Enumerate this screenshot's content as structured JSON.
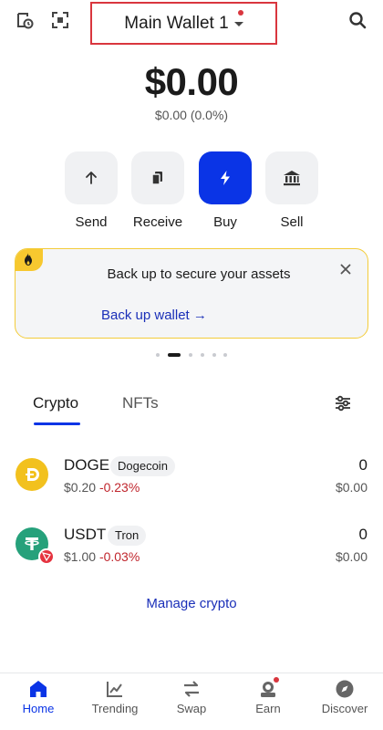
{
  "header": {
    "wallet_name": "Main Wallet 1",
    "icons": [
      "wallet-history-icon",
      "scan-qr-icon",
      "search-icon"
    ]
  },
  "balance": {
    "amount": "$0.00",
    "change": "$0.00 (0.0%)"
  },
  "actions": [
    {
      "label": "Send",
      "icon": "arrow-up-icon"
    },
    {
      "label": "Receive",
      "icon": "cards-icon"
    },
    {
      "label": "Buy",
      "icon": "bolt-icon"
    },
    {
      "label": "Sell",
      "icon": "bank-icon"
    }
  ],
  "banner": {
    "title": "Back up to secure your assets",
    "link": "Back up wallet →",
    "icon": "fire-icon"
  },
  "tabs": {
    "crypto": "Crypto",
    "nfts": "NFTs",
    "active": "Crypto"
  },
  "assets": [
    {
      "symbol": "DOGE",
      "network": "Dogecoin",
      "price": "$0.20",
      "change": "-0.23%",
      "quantity": "0",
      "fiat": "$0.00"
    },
    {
      "symbol": "USDT",
      "network": "Tron",
      "price": "$1.00",
      "change": "-0.03%",
      "quantity": "0",
      "fiat": "$0.00"
    }
  ],
  "manage_link": "Manage crypto",
  "nav": [
    {
      "label": "Home",
      "icon": "home-icon",
      "active": true
    },
    {
      "label": "Trending",
      "icon": "trending-icon"
    },
    {
      "label": "Swap",
      "icon": "swap-icon"
    },
    {
      "label": "Earn",
      "icon": "earn-icon"
    },
    {
      "label": "Discover",
      "icon": "compass-icon"
    }
  ],
  "colors": {
    "primary": "#0a34e6",
    "negative": "#c0262d",
    "highlight_border": "#d9363e",
    "banner_border": "#f3cc3a"
  }
}
